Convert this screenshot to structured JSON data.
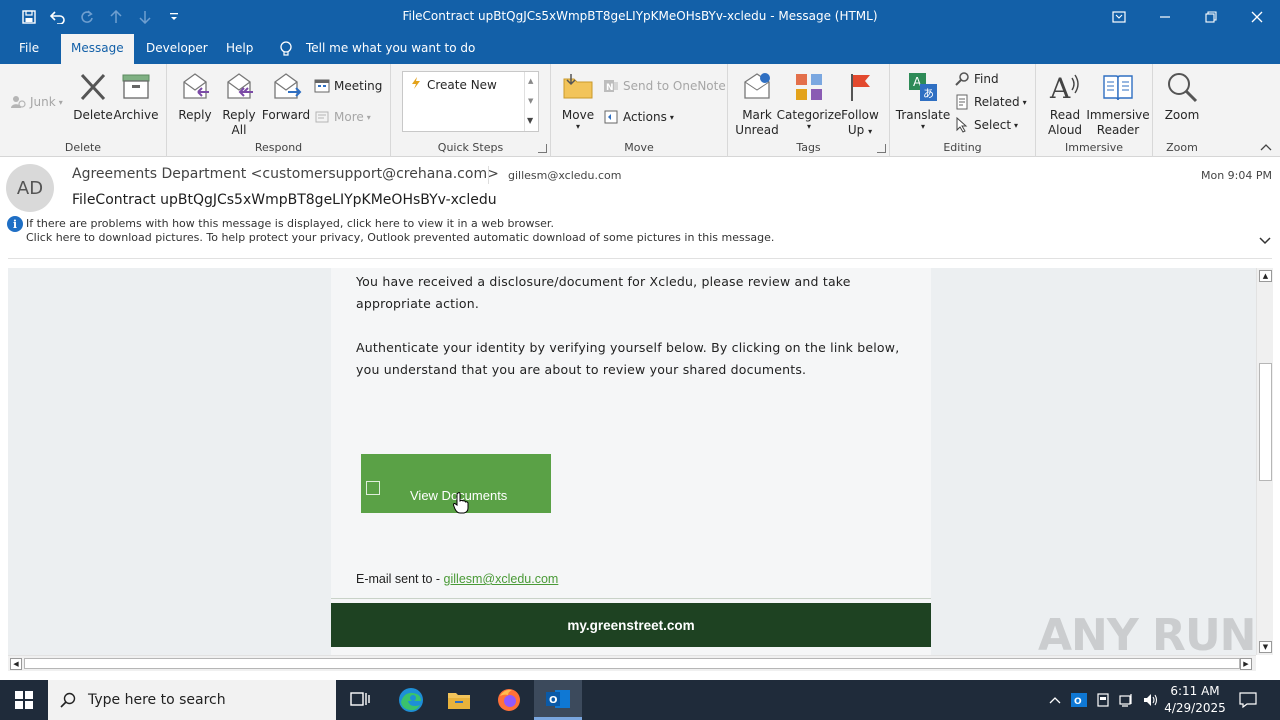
{
  "window": {
    "title": "FileContract upBtQgJCs5xWmpBT8geLIYpKMeOHsBYv-xcledu  -  Message (HTML)"
  },
  "ribbon_tabs": [
    "File",
    "Message",
    "Developer",
    "Help"
  ],
  "tell_me": "Tell me what you want to do",
  "ribbon": {
    "delete_group": {
      "label": "Delete",
      "junk": "Junk",
      "delete": "Delete",
      "archive": "Archive"
    },
    "respond_group": {
      "label": "Respond",
      "reply": "Reply",
      "reply_all_1": "Reply",
      "reply_all_2": "All",
      "forward": "Forward",
      "meeting": "Meeting",
      "more": "More"
    },
    "quick_steps": {
      "label": "Quick Steps",
      "create_new": "Create New"
    },
    "move_group": {
      "label": "Move",
      "move": "Move",
      "send_onenote": "Send to OneNote",
      "actions": "Actions"
    },
    "tags_group": {
      "label": "Tags",
      "mark_unread_1": "Mark",
      "mark_unread_2": "Unread",
      "categorize": "Categorize",
      "follow_up_1": "Follow",
      "follow_up_2": "Up"
    },
    "editing_group": {
      "label": "Editing",
      "translate": "Translate",
      "find": "Find",
      "related": "Related",
      "select": "Select"
    },
    "immersive_group": {
      "label": "Immersive",
      "read_aloud_1": "Read",
      "read_aloud_2": "Aloud",
      "immersive_reader_1": "Immersive",
      "immersive_reader_2": "Reader"
    },
    "zoom_group": {
      "label": "Zoom",
      "zoom": "Zoom"
    }
  },
  "message": {
    "avatar_initials": "AD",
    "from": "Agreements Department <customersupport@crehana.com>",
    "to": "gillesm@xcledu.com",
    "date": "Mon 9:04 PM",
    "subject": "FileContract upBtQgJCs5xWmpBT8geLIYpKMeOHsBYv-xcledu",
    "info_line_1": "If there are problems with how this message is displayed, click here to view it in a web browser.",
    "info_line_2": "Click here to download pictures. To help protect your privacy, Outlook prevented automatic download of some pictures in this message."
  },
  "email_body": {
    "paragraph_1": "You have received a disclosure/document for Xcledu, please review and take appropriate action.",
    "paragraph_2": "Authenticate your identity by verifying yourself below. By clicking on the link below, you understand that you are about to review your shared documents.",
    "button_label": "View Documents",
    "sent_to_label": "E-mail sent to - ",
    "sent_to_email": "gillesm@xcledu.com",
    "footer_text": "my.greenstreet.com"
  },
  "watermark": "ANY RUN",
  "taskbar": {
    "search_placeholder": "Type here to search",
    "time": "6:11 AM",
    "date": "4/29/2025"
  },
  "colors": {
    "titlebar": "#1360a8",
    "button_green": "#5aa146",
    "footer_green": "#1e4222",
    "link_green": "#4a9a37"
  }
}
